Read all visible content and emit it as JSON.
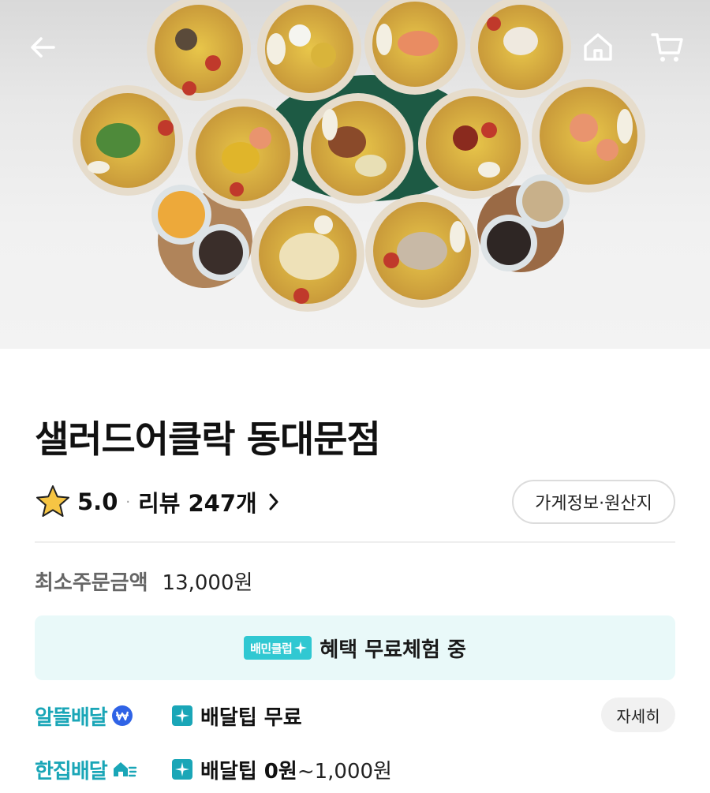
{
  "header": {
    "back_icon": "arrow-left-icon",
    "home_icon": "home-icon",
    "cart_icon": "cart-icon"
  },
  "hero": {
    "image": "salad-bowls-photo"
  },
  "store": {
    "name": "샐러드어클락 동대문점",
    "rating": "5.0",
    "review_label": "리뷰",
    "review_count": "247개",
    "info_button": "가게정보·원산지"
  },
  "order": {
    "min_label": "최소주문금액",
    "min_value": "13,000원"
  },
  "club": {
    "badge": "배민클럽",
    "text": "혜택 무료체험 중"
  },
  "delivery": [
    {
      "name": "알뜰배달",
      "tip": "배달팁 무료",
      "tip_range": "",
      "detail": "자세히"
    },
    {
      "name": "한집배달",
      "tip": "배달팁 0원",
      "tip_range": "~1,000원",
      "detail": ""
    }
  ],
  "colors": {
    "accent": "#1aa6b7",
    "club_bg": "#e9f9f9",
    "club_badge": "#30c8d2",
    "star": "#f6c544"
  }
}
